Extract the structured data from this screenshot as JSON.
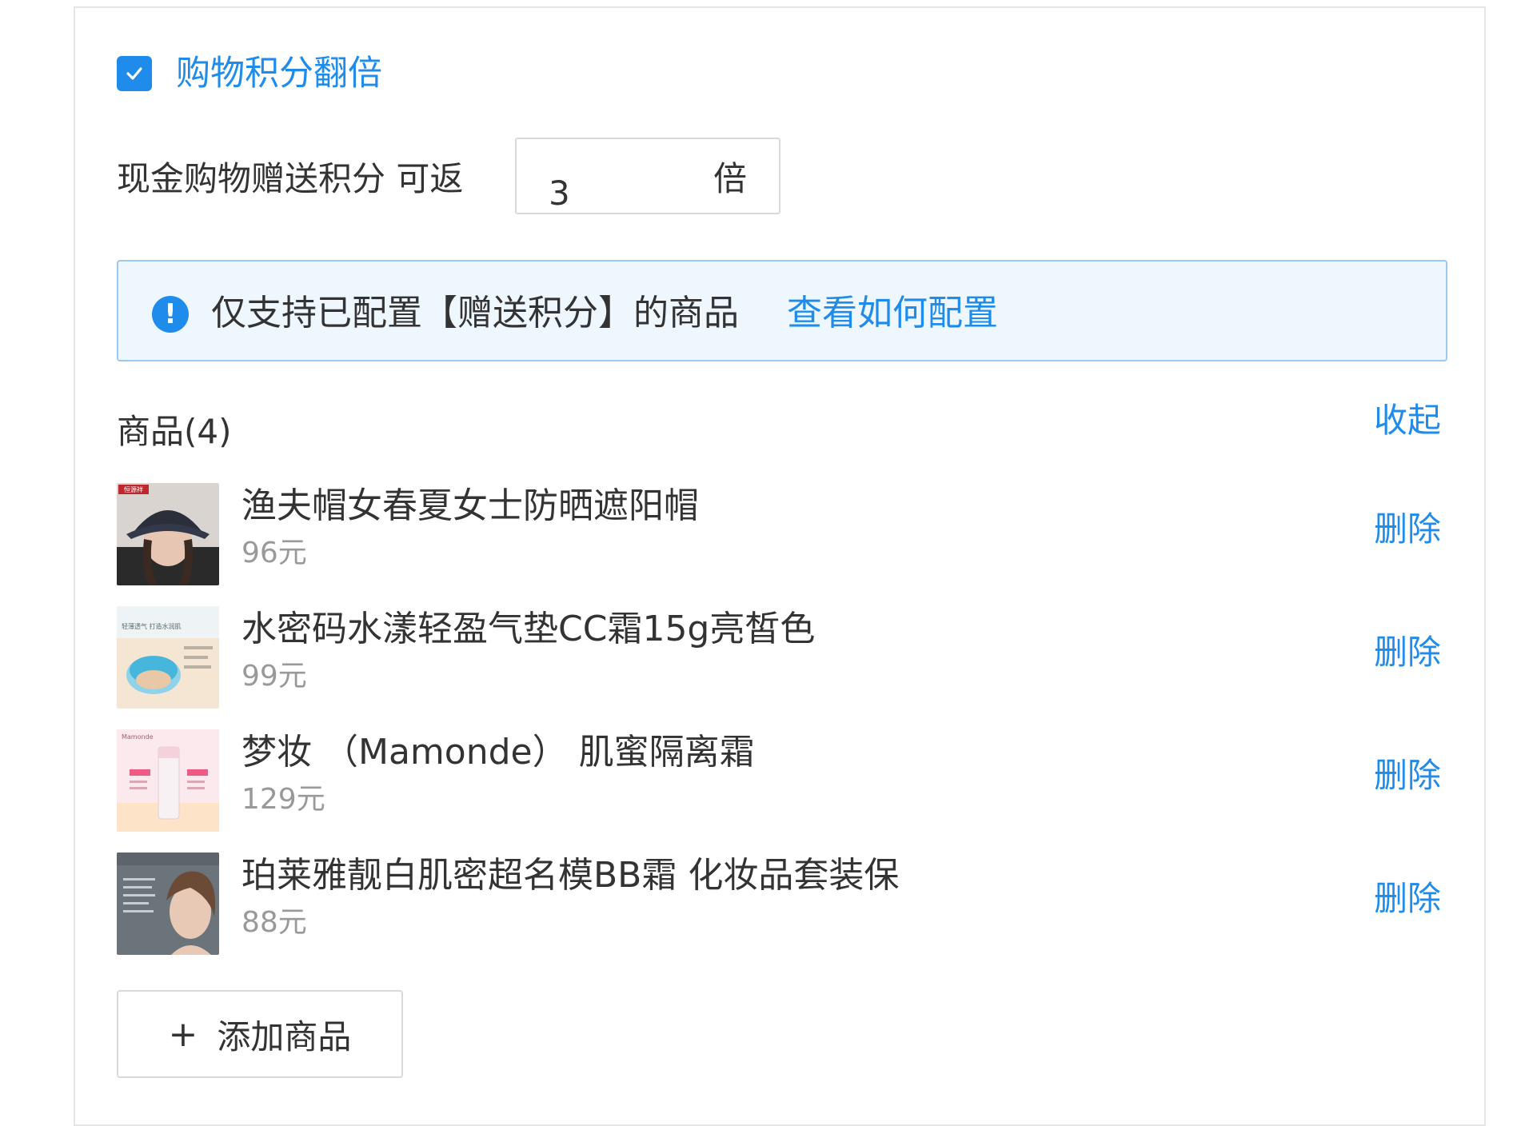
{
  "points_double": {
    "checked": true,
    "title": "购物积分翻倍"
  },
  "multiplier": {
    "label": "现金购物赠送积分 可返",
    "value": "3",
    "unit": "倍"
  },
  "notice": {
    "icon": "info-exclamation-icon",
    "text": "仅支持已配置【赠送积分】的商品",
    "link": "查看如何配置"
  },
  "products": {
    "header": "商品(4)",
    "collapse_label": "收起",
    "items": [
      {
        "name": "渔夫帽女春夏女士防晒遮阳帽",
        "price": "96元",
        "delete_label": "删除",
        "thumb_badge": "恒源祥"
      },
      {
        "name": "水密码水漾轻盈气垫CC霜15g亮皙色",
        "price": "99元",
        "delete_label": "删除",
        "thumb_badge": "轻薄透气 打造水润肌"
      },
      {
        "name": "梦妆 （Mamonde） 肌蜜隔离霜",
        "price": "129元",
        "delete_label": "删除",
        "thumb_badge": "Mamonde"
      },
      {
        "name": "珀莱雅靓白肌密超名模BB霜 化妆品套装保",
        "price": "88元",
        "delete_label": "删除",
        "thumb_badge": ""
      }
    ],
    "add_label": "添加商品"
  },
  "colors": {
    "accent": "#1f8ceb",
    "notice_bg": "#eef6fe",
    "notice_border": "#9dc8f2",
    "muted_text": "#999999"
  }
}
